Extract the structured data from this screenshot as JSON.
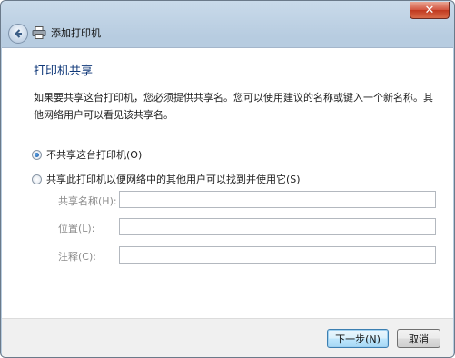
{
  "window": {
    "title": "添加打印机",
    "close_glyph": "✕"
  },
  "page": {
    "heading": "打印机共享",
    "description": "如果要共享这台打印机，您必须提供共享名。您可以使用建议的名称或键入一个新名称。其他网络用户可以看见该共享名。"
  },
  "options": {
    "no_share_label": "不共享这台打印机(O)",
    "share_label": "共享此打印机以便网络中的其他用户可以找到并使用它(S)",
    "selected": "no_share"
  },
  "fields": {
    "share_name_label": "共享名称(H):",
    "share_name_value": "",
    "location_label": "位置(L):",
    "location_value": "",
    "comment_label": "注释(C):",
    "comment_value": ""
  },
  "buttons": {
    "next_label": "下一步(N)",
    "cancel_label": "取消"
  },
  "icons": {
    "back": "back-arrow-icon",
    "printer": "printer-icon",
    "close": "close-icon"
  },
  "colors": {
    "heading": "#123a7a",
    "accent": "#3c7fb1"
  }
}
